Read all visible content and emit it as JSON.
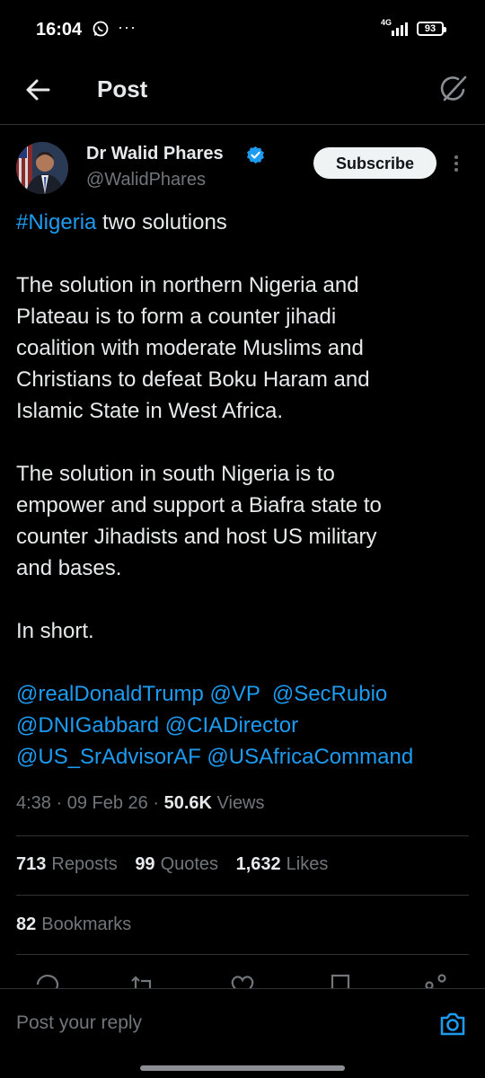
{
  "status_bar": {
    "time": "16:04",
    "network": "4G",
    "battery": "93",
    "icons": [
      "whatsapp-icon",
      "more-dots-icon",
      "signal-icon",
      "battery-icon"
    ]
  },
  "header": {
    "title": "Post",
    "back_icon": "arrow-left-icon",
    "grok_icon": "grok-icon"
  },
  "author": {
    "name": "Dr Walid Phares",
    "handle": "@WalidPhares",
    "subscribe_label": "Subscribe",
    "verified": true
  },
  "tweet": {
    "hashtag": "#Nigeria",
    "first_line_rest": " two solutions",
    "para1_lines": [
      "The solution in northern Nigeria and",
      "Plateau is to form a counter jihadi",
      "coalition with moderate Muslims and",
      "Christians to defeat Boku Haram and",
      "Islamic State in West Africa."
    ],
    "para2_lines": [
      "The solution in south Nigeria is to",
      "empower and support a Biafra state to",
      "counter Jihadists and host US military",
      "and bases."
    ],
    "para3": "In short.",
    "mentions_lines": [
      "@realDonaldTrump @VP  @SecRubio",
      "@DNIGabbard @CIADirector",
      "@US_SrAdvisorAF @USAfricaCommand"
    ]
  },
  "meta": {
    "time": "4:38",
    "date": "09 Feb 26",
    "views_count": "50.6K",
    "views_label": "Views"
  },
  "stats": {
    "reposts_count": "713",
    "reposts_label": "Reposts",
    "quotes_count": "99",
    "quotes_label": "Quotes",
    "likes_count": "1,632",
    "likes_label": "Likes",
    "bookmarks_count": "82",
    "bookmarks_label": "Bookmarks"
  },
  "reply": {
    "placeholder": "Post your reply"
  },
  "colors": {
    "background": "#000000",
    "text": "#e7e9ea",
    "muted": "#71767b",
    "link": "#1d9bf0",
    "divider": "#2f3336"
  }
}
